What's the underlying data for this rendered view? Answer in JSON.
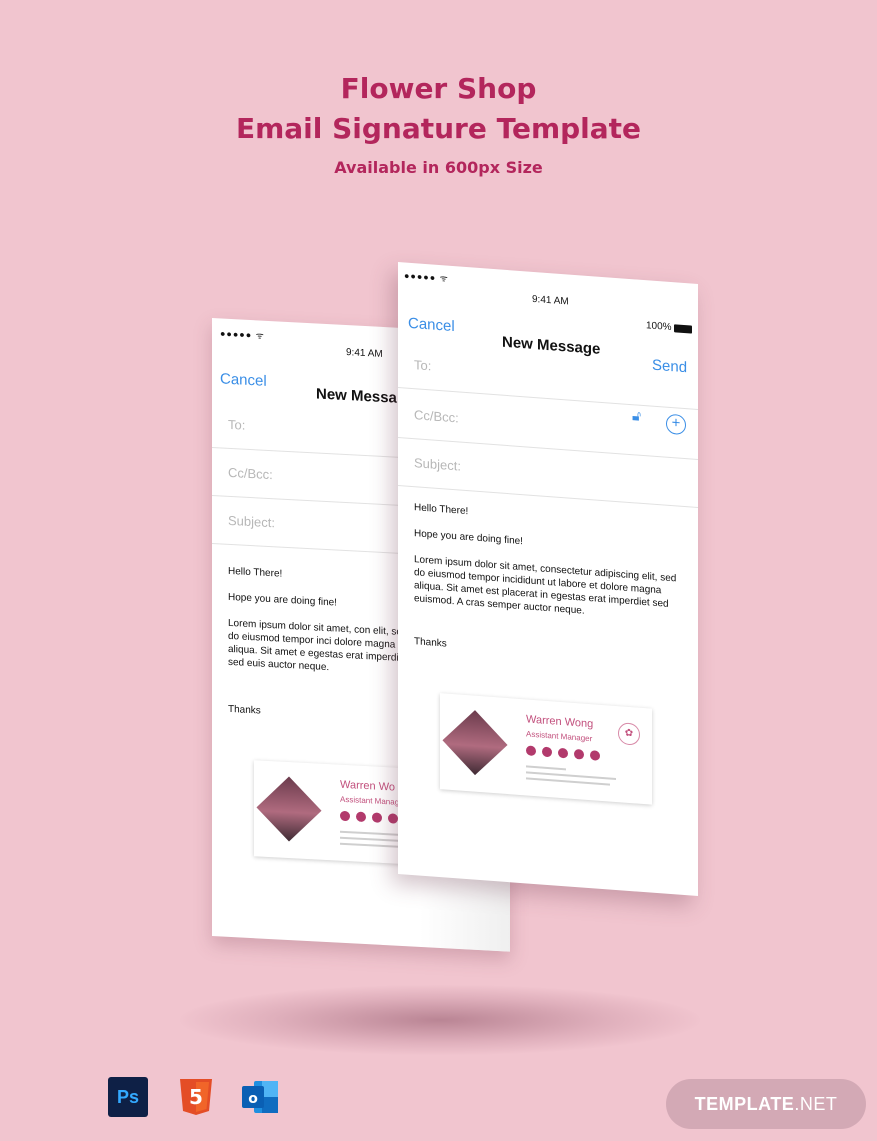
{
  "header": {
    "title_line1": "Flower Shop",
    "title_line2": "Email Signature Template",
    "subtitle": "Available in 600px Size"
  },
  "phone_front": {
    "time": "9:41 AM",
    "battery": "100%",
    "cancel": "Cancel",
    "title": "New Message",
    "send": "Send",
    "to_placeholder": "To:",
    "cc_placeholder": "Cc/Bcc:",
    "subject_placeholder": "Subject:",
    "greeting": "Hello There!",
    "line2": "Hope you are doing fine!",
    "lorem": "Lorem ipsum dolor sit amet, consectetur adipiscing elit, sed do eiusmod tempor incididunt ut labore et dolore magna aliqua. Sit amet est placerat in egestas erat imperdiet sed euismod. A cras semper auctor neque.",
    "thanks": "Thanks",
    "sig_name": "Warren Wong",
    "sig_role": "Assistant Manager"
  },
  "phone_back": {
    "time": "9:41 AM",
    "cancel": "Cancel",
    "title": "New Messa",
    "to_placeholder": "To:",
    "cc_placeholder": "Cc/Bcc:",
    "subject_placeholder": "Subject:",
    "greeting": "Hello There!",
    "line2": "Hope you are doing fine!",
    "lorem": "Lorem ipsum dolor sit amet, con elit, sed do eiusmod tempor inci dolore magna aliqua. Sit amet e egestas erat imperdiet sed euis auctor neque.",
    "thanks": "Thanks",
    "sig_name": "Warren Wo",
    "sig_role": "Assistant Manag"
  },
  "footer": {
    "ps_label": "Ps",
    "badge_main": "TEMPLATE",
    "badge_suffix": ".NET"
  },
  "colors": {
    "background": "#f1c5cf",
    "title": "#b3265c",
    "ios_blue": "#3a8ee6",
    "signature_pink": "#c2507d"
  }
}
